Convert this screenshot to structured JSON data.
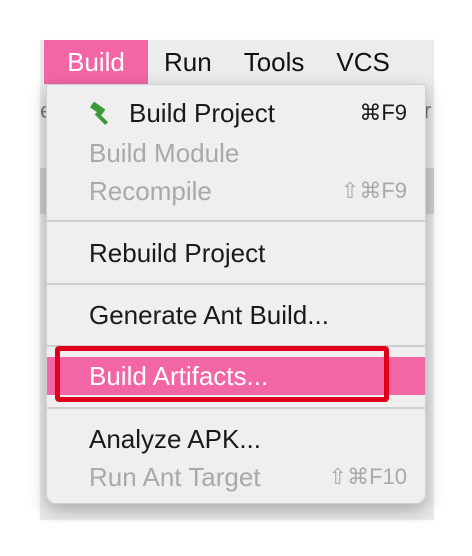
{
  "menubar": {
    "items": [
      {
        "label": "Build",
        "active": true
      },
      {
        "label": "Run",
        "active": false
      },
      {
        "label": "Tools",
        "active": false
      },
      {
        "label": "VCS",
        "active": false
      }
    ]
  },
  "build_menu": {
    "build_project": {
      "label": "Build Project",
      "shortcut": "⌘F9",
      "icon": "hammer-icon"
    },
    "build_module": {
      "label": "Build Module"
    },
    "recompile": {
      "label": "Recompile",
      "shortcut": "⇧⌘F9"
    },
    "rebuild_project": {
      "label": "Rebuild Project"
    },
    "generate_ant_build": {
      "label": "Generate Ant Build..."
    },
    "build_artifacts": {
      "label": "Build Artifacts..."
    },
    "analyze_apk": {
      "label": "Analyze APK..."
    },
    "run_ant_target": {
      "label": "Run Ant Target",
      "shortcut": "⇧⌘F10"
    }
  },
  "colors": {
    "accent": "#f266a6",
    "annotation": "#e0001b",
    "hammer": "#3a9a3a"
  }
}
